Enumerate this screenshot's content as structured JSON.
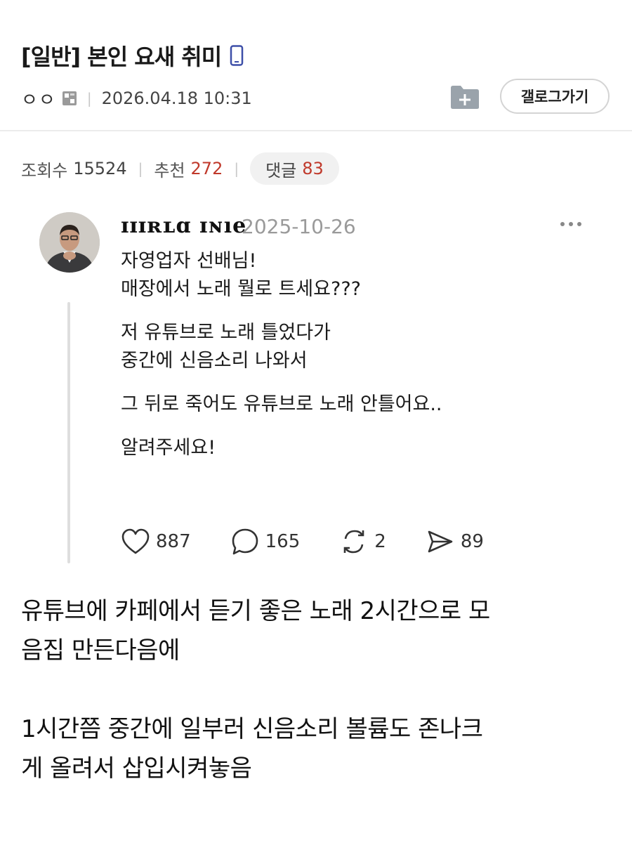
{
  "post": {
    "title": "[일반] 본인 요새 취미",
    "author": "ㅇㅇ",
    "date": "2026.04.18 10:31",
    "gallery_button": "갤로그가기"
  },
  "stats": {
    "views_label": "조회수",
    "views": "15524",
    "recommend_label": "추천",
    "recommend": "272",
    "comments_label": "댓글",
    "comments": "83"
  },
  "embed": {
    "username": "ɪɪɪʀʟɑ ɪɴıe",
    "date": "2025-10-26",
    "paragraphs": [
      [
        "자영업자 선배님!",
        "매장에서 노래 뭘로 트세요???"
      ],
      [
        "저 유튜브로 노래 틀었다가",
        "중간에 신음소리 나와서"
      ],
      [
        "그 뒤로 죽어도 유튜브로 노래 안틀어요.."
      ],
      [
        "알려주세요!"
      ]
    ],
    "likes": "887",
    "replies": "165",
    "reposts": "2",
    "shares": "89"
  },
  "body": {
    "lines": [
      [
        "유튜브에 카페에서 듣기 좋은 노래 2시간으로 모",
        "음집 만든다음에"
      ],
      [
        "1시간쯤 중간에 일부러 신음소리 볼륨도 존나크",
        "게 올려서 삽입시켜놓음"
      ]
    ]
  },
  "colors": {
    "accent_red": "#c0392b",
    "phone_icon": "#3d4fa8",
    "divider": "#ececec"
  },
  "icons": [
    "phone-icon",
    "gallery-badge-icon",
    "add-icon",
    "more-icon",
    "heart-icon",
    "comment-bubble-icon",
    "repost-icon",
    "share-icon"
  ]
}
